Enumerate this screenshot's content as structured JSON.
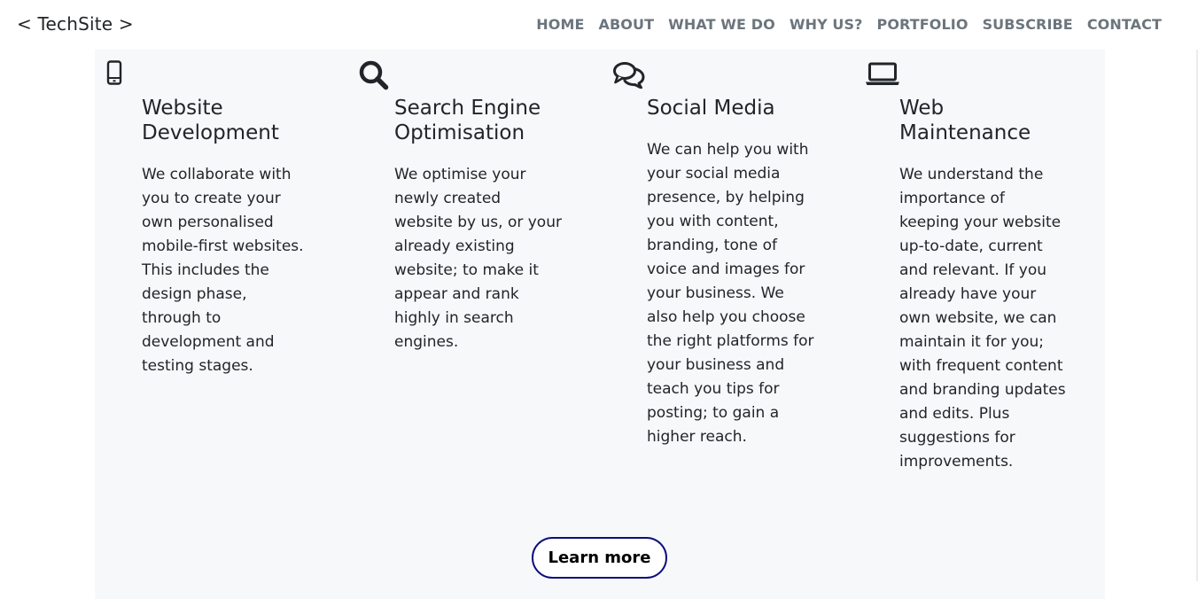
{
  "nav": {
    "brand": "< TechSite >",
    "links": [
      "HOME",
      "ABOUT",
      "WHAT WE DO",
      "WHY US?",
      "PORTFOLIO",
      "SUBSCRIBE",
      "CONTACT"
    ]
  },
  "services": [
    {
      "icon": "mobile-phone-icon",
      "title": "Website Development",
      "text": "We collaborate with you to create your own personalised mobile-first websites. This includes the design phase, through to development and testing stages."
    },
    {
      "icon": "search-icon",
      "title": "Search Engine Optimisation",
      "text": "We optimise your newly created website by us, or your already existing website; to make it appear and rank highly in search engines."
    },
    {
      "icon": "chat-bubbles-icon",
      "title": "Social Media",
      "text": "We can help you with your social media presence, by helping you with content, branding, tone of voice and images for your business. We also help you choose the right platforms for your business and teach you tips for posting; to gain a higher reach."
    },
    {
      "icon": "laptop-icon",
      "title": "Web Maintenance",
      "text": "We understand the importance of keeping your website up-to-date, current and relevant. If you already have your own website, we can maintain it for you; with frequent content and branding updates and edits. Plus suggestions for improvements."
    }
  ],
  "cta": {
    "label": "Learn more"
  },
  "colors": {
    "nav_link": "#6c757d",
    "section_bg": "#f6f8f9",
    "button_border": "#0d0d7a",
    "text": "#212529"
  }
}
